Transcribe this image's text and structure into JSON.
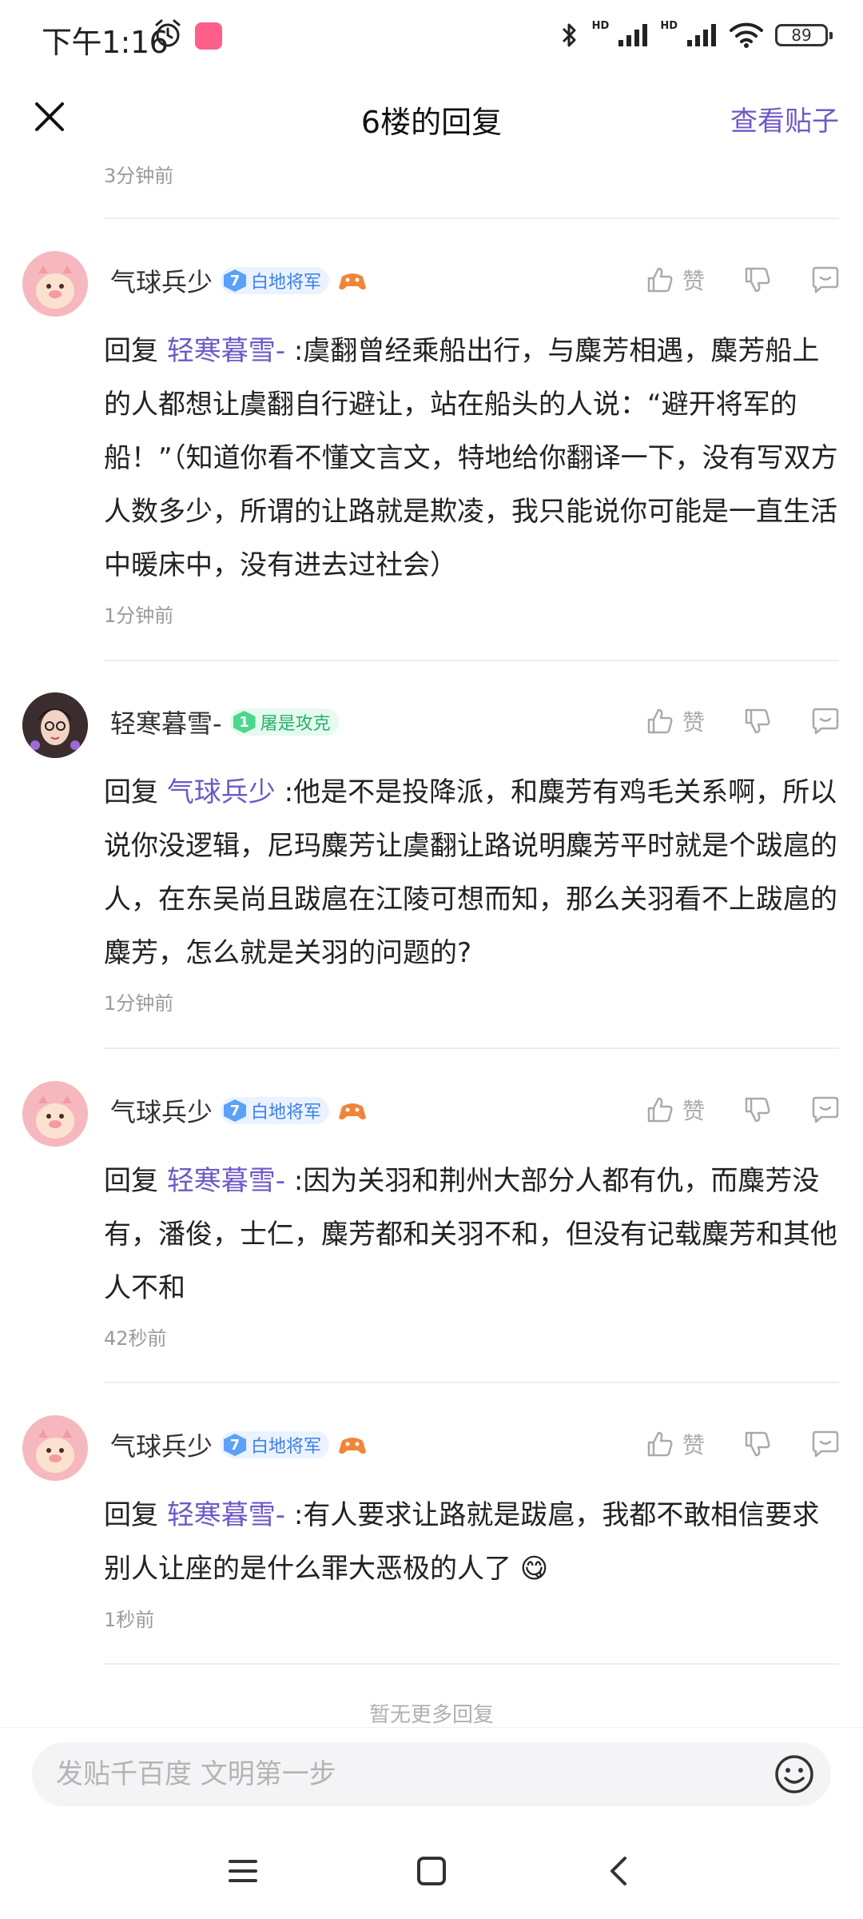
{
  "status_bar": {
    "time": "下午1:16",
    "battery": "89"
  },
  "header": {
    "title": "6楼的回复",
    "view_post": "查看贴子"
  },
  "top_time": "3分钟前",
  "like_label": "赞",
  "replies": [
    {
      "username": "气球兵少",
      "level": "7",
      "badge": "白地将军",
      "avatar": "pig",
      "prefix": "回复 ",
      "mention": "轻寒暮雪-",
      "text": " :虞翻曾经乘船出行，与麋芳相遇，麋芳船上的人都想让虞翻自行避让，站在船头的人说：“避开将军的船！”（知道你看不懂文言文，特地给你翻译一下，没有写双方人数多少，所谓的让路就是欺凌，我只能说你可能是一直生活中暖床中，没有进去过社会）",
      "time": "1分钟前"
    },
    {
      "username": "轻寒暮雪-",
      "level": "1",
      "badge": "屠是攻克",
      "avatar": "girl",
      "prefix": "回复 ",
      "mention": "气球兵少",
      "text": " :他是不是投降派，和麋芳有鸡毛关系啊，所以说你没逻辑，尼玛麋芳让虞翻让路说明麋芳平时就是个跋扈的人，在东吴尚且跋扈在江陵可想而知，那么关羽看不上跋扈的麋芳，怎么就是关羽的问题的?",
      "time": "1分钟前"
    },
    {
      "username": "气球兵少",
      "level": "7",
      "badge": "白地将军",
      "avatar": "pig",
      "prefix": "回复 ",
      "mention": "轻寒暮雪-",
      "text": " :因为关羽和荆州大部分人都有仇，而麋芳没有，潘俊，士仁，麋芳都和关羽不和，但没有记载麋芳和其他人不和",
      "time": "42秒前"
    },
    {
      "username": "气球兵少",
      "level": "7",
      "badge": "白地将军",
      "avatar": "pig",
      "prefix": "回复 ",
      "mention": "轻寒暮雪-",
      "text": " :有人要求让路就是跋扈，我都不敢相信要求别人让座的是什么罪大恶极的人了 😋",
      "time": "1秒前"
    }
  ],
  "no_more": "暂无更多回复",
  "input": {
    "placeholder": "发贴千百度 文明第一步"
  }
}
